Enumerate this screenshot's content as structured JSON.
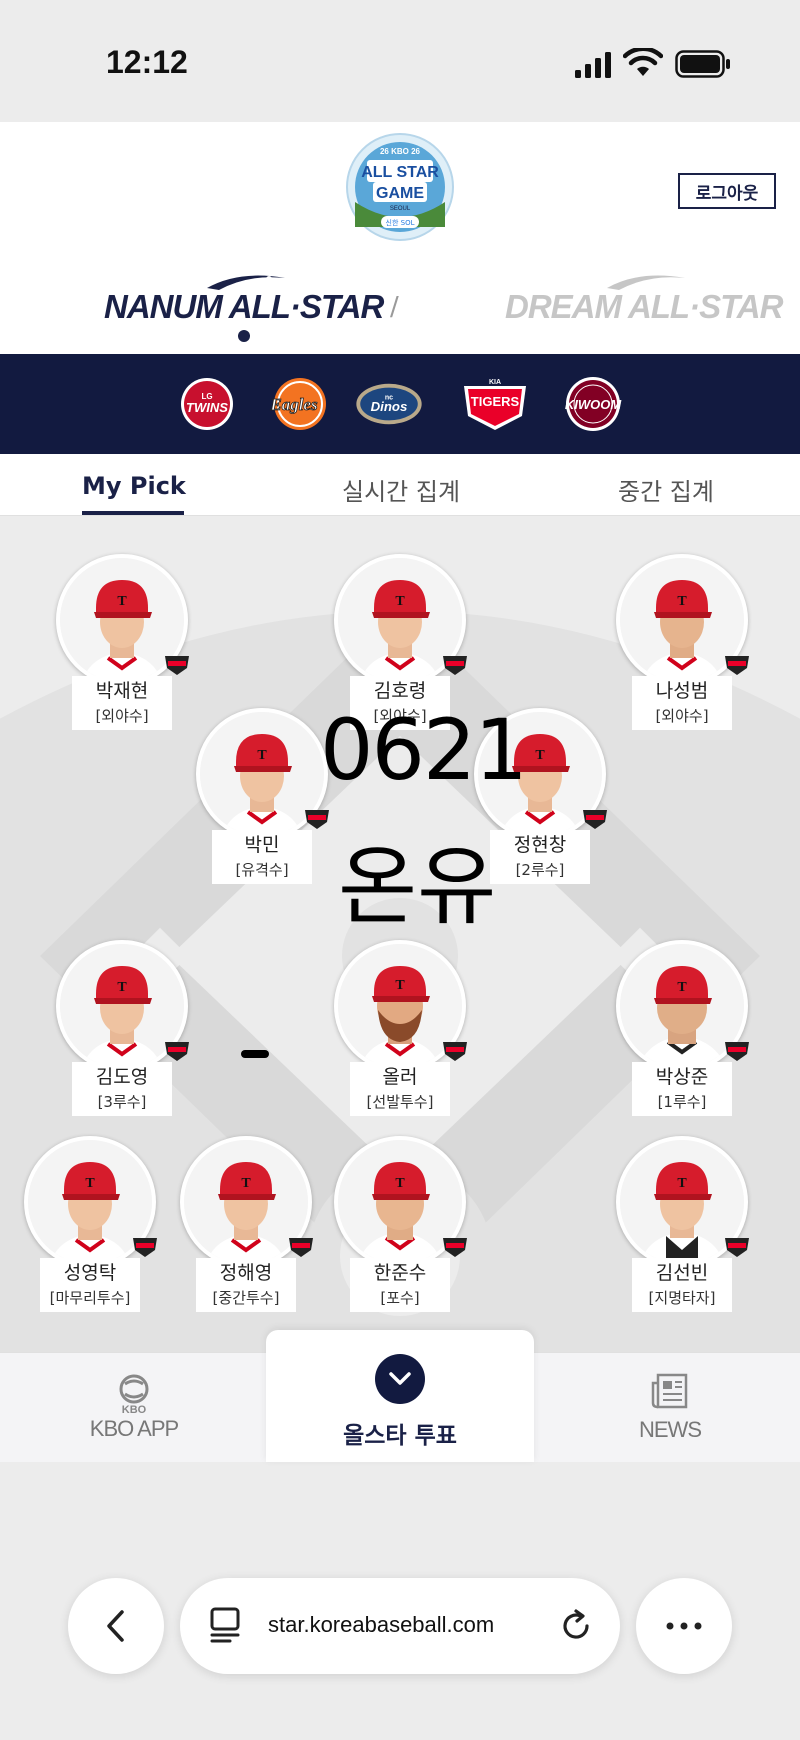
{
  "status": {
    "time": "12:12"
  },
  "header": {
    "logo_alt": "26 KBO 26 ALL-STAR GAME SEOUL 신한 SOL",
    "logout_label": "로그아웃",
    "leagues": [
      {
        "label": "NANUM ALL·STAR",
        "active": true
      },
      {
        "label": "DREAM ALL·STAR",
        "active": false
      }
    ],
    "separator": "/"
  },
  "teams": [
    {
      "name": "LG TWINS",
      "icon": "lg-twins-logo",
      "color": "#c8102e"
    },
    {
      "name": "Eagles",
      "icon": "hanwha-eagles-logo",
      "color": "#f37321"
    },
    {
      "name": "NC Dinos",
      "icon": "nc-dinos-logo",
      "color": "#315288"
    },
    {
      "name": "TIGERS",
      "icon": "kia-tigers-logo",
      "color": "#ea0029"
    },
    {
      "name": "KIWOOM",
      "icon": "kiwoom-heroes-logo",
      "color": "#820024"
    }
  ],
  "tabs": [
    {
      "label": "My Pick",
      "active": true
    },
    {
      "label": "실시간 집계",
      "active": false
    },
    {
      "label": "중간 집계",
      "active": false
    }
  ],
  "players": [
    {
      "name": "박재현",
      "position": "[외야수]"
    },
    {
      "name": "김호령",
      "position": "[외야수]"
    },
    {
      "name": "나성범",
      "position": "[외야수]"
    },
    {
      "name": "박민",
      "position": "[유격수]"
    },
    {
      "name": "정현창",
      "position": "[2루수]"
    },
    {
      "name": "김도영",
      "position": "[3루수]"
    },
    {
      "name": "올러",
      "position": "[선발투수]"
    },
    {
      "name": "박상준",
      "position": "[1루수]"
    },
    {
      "name": "성영탁",
      "position": "[마무리투수]"
    },
    {
      "name": "정해영",
      "position": "[중간투수]"
    },
    {
      "name": "한준수",
      "position": "[포수]"
    },
    {
      "name": "김선빈",
      "position": "[지명타자]"
    }
  ],
  "overlay": {
    "number": "0621",
    "name": "온유"
  },
  "bottom_nav": {
    "kbo_small": "KBO",
    "kbo_label": "KBO APP",
    "vote_label": "올스타 투표",
    "news_label": "NEWS"
  },
  "browser": {
    "url": "star.koreabaseball.com"
  },
  "colors": {
    "navy": "#121a40",
    "tigers_red": "#ea0029"
  }
}
